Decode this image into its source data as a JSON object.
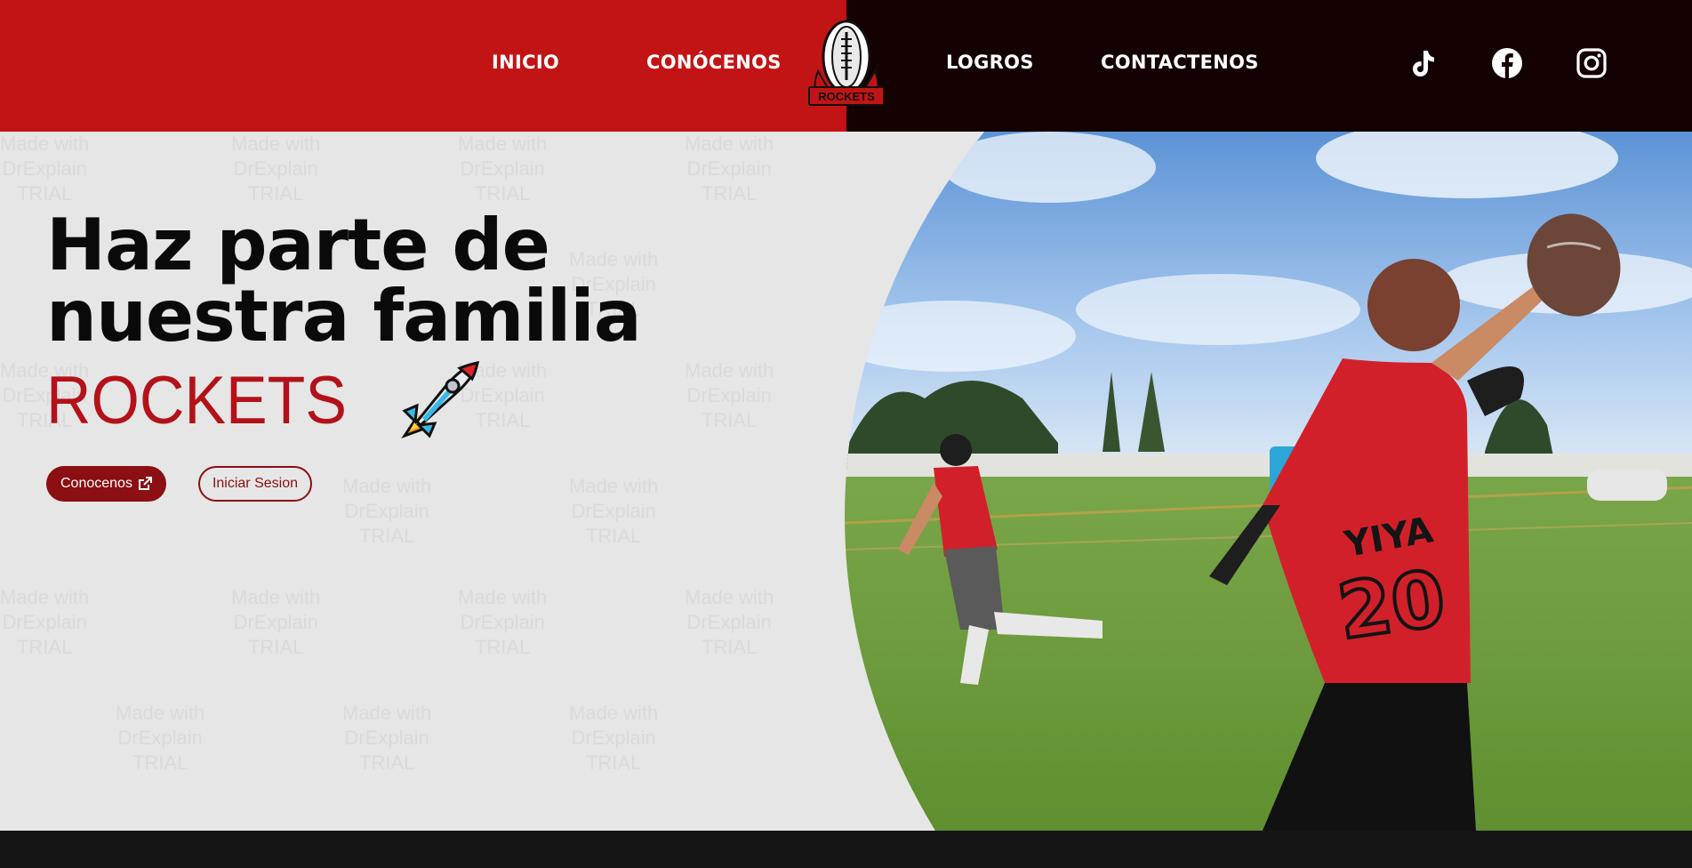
{
  "nav": {
    "left": [
      "INICIO",
      "CONÓCENOS"
    ],
    "right": [
      "LOGROS",
      "CONTACTENOS"
    ],
    "logo_text": "ROCKETS"
  },
  "social": [
    "tiktok-icon",
    "facebook-icon",
    "instagram-icon"
  ],
  "hero": {
    "headline": "Haz parte de nuestra familia",
    "brand": "ROCKETS",
    "btn_primary": "Conocenos",
    "btn_secondary": "Iniciar Sesion"
  },
  "photo": {
    "jersey_name": "YIYA",
    "jersey_number": "20"
  },
  "watermark": [
    "Made with",
    "DrExplain",
    "TRIAL"
  ],
  "colors": {
    "red": "#c31415",
    "dark": "#140203",
    "brand_red": "#b3121a",
    "button": "#8b0f13"
  }
}
